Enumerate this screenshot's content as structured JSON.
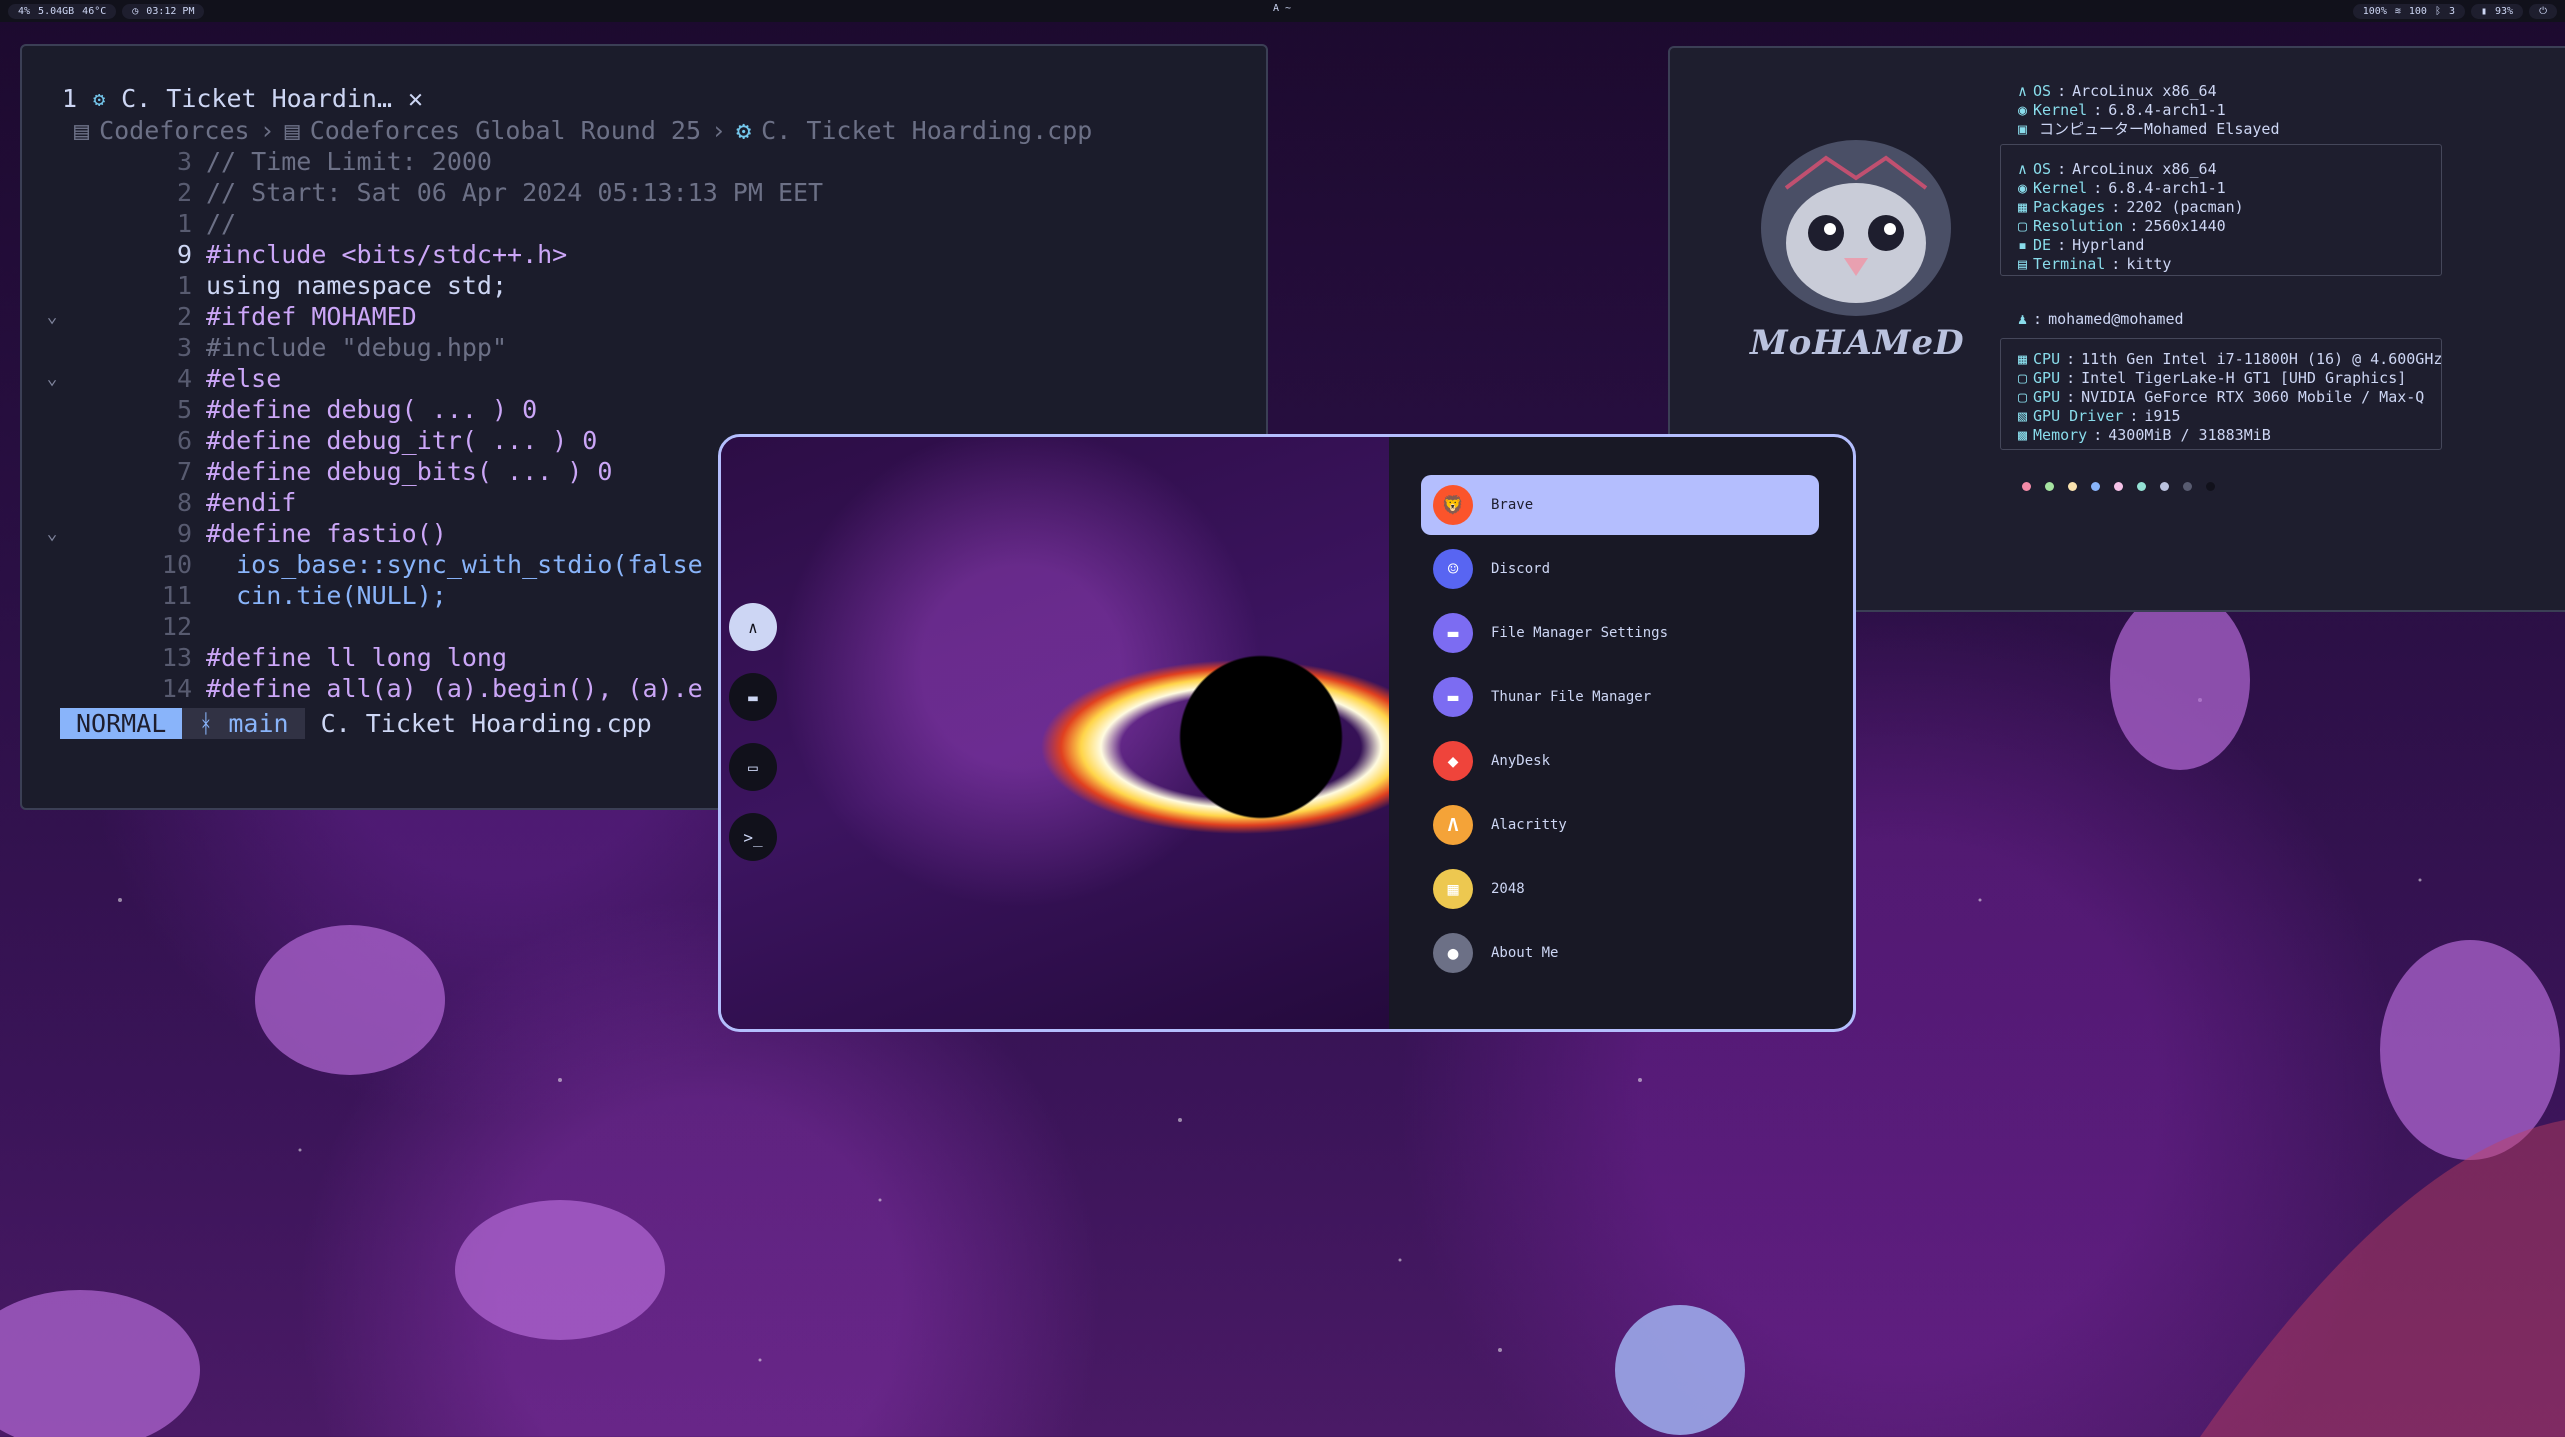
{
  "topbar": {
    "left": {
      "cpu": "4%",
      "mem": "5.04GB",
      "temp": "46°C",
      "clock": "03:12 PM"
    },
    "center": "A ~",
    "right": {
      "brightness": "100%",
      "volume": "100",
      "notifications": "3",
      "battery": "93%"
    }
  },
  "editor": {
    "tab_number": "1",
    "tab_title": "C. Ticket Hoardin…",
    "tab_close": "✕",
    "breadcrumb": [
      "Codeforces",
      "Codeforces Global Round 25",
      "C. Ticket Hoarding.cpp"
    ],
    "lines": [
      {
        "fold": "",
        "num": "3",
        "text": "// Time Limit: 2000",
        "kind": "comment"
      },
      {
        "fold": "",
        "num": "2",
        "text": "// Start: Sat 06 Apr 2024 05:13:13 PM EET",
        "kind": "comment"
      },
      {
        "fold": "",
        "num": "1",
        "text": "//",
        "kind": "comment"
      },
      {
        "fold": "",
        "num": "9",
        "text": "#include <bits/stdc++.h>",
        "kind": "include",
        "current": true
      },
      {
        "fold": "",
        "num": "1",
        "text": "using namespace std;",
        "kind": "plain"
      },
      {
        "fold": "⌄",
        "num": "2",
        "text": "#ifdef MOHAMED",
        "kind": "pre"
      },
      {
        "fold": "",
        "num": "3",
        "text": "#include \"debug.hpp\"",
        "kind": "comment"
      },
      {
        "fold": "⌄",
        "num": "4",
        "text": "#else",
        "kind": "pre"
      },
      {
        "fold": "",
        "num": "5",
        "text": "#define debug( ... ) 0",
        "kind": "define"
      },
      {
        "fold": "",
        "num": "6",
        "text": "#define debug_itr( ... ) 0",
        "kind": "define"
      },
      {
        "fold": "",
        "num": "7",
        "text": "#define debug_bits( ... ) 0",
        "kind": "define"
      },
      {
        "fold": "",
        "num": "8",
        "text": "#endif",
        "kind": "pre"
      },
      {
        "fold": "⌄",
        "num": "9",
        "text": "#define fastio()",
        "kind": "pre"
      },
      {
        "fold": "",
        "num": "10",
        "text": "  ios_base::sync_with_stdio(false",
        "kind": "fn"
      },
      {
        "fold": "",
        "num": "11",
        "text": "  cin.tie(NULL);",
        "kind": "fn"
      },
      {
        "fold": "",
        "num": "12",
        "text": "",
        "kind": "plain"
      },
      {
        "fold": "",
        "num": "13",
        "text": "#define ll long long",
        "kind": "pre"
      },
      {
        "fold": "",
        "num": "14",
        "text": "#define all(a) (a).begin(), (a).e",
        "kind": "pre"
      }
    ],
    "status": {
      "mode": "NORMAL",
      "branch": " main",
      "file": "C. Ticket Hoarding.cpp"
    }
  },
  "fetch": {
    "logo_text": "MoHAMeD",
    "header": [
      {
        "key": "OS",
        "value": "ArcoLinux x86_64"
      },
      {
        "key": "Kernel",
        "value": "6.8.4-arch1-1"
      },
      {
        "key": "",
        "value": "コンピューターMohamed Elsayed"
      }
    ],
    "system": [
      {
        "key": "OS",
        "value": "ArcoLinux x86_64"
      },
      {
        "key": "Kernel",
        "value": "6.8.4-arch1-1"
      },
      {
        "key": "Packages",
        "value": "2202 (pacman)"
      },
      {
        "key": "Resolution",
        "value": "2560x1440"
      },
      {
        "key": "DE",
        "value": "Hyprland"
      },
      {
        "key": "Terminal",
        "value": "kitty"
      }
    ],
    "user": "mohamed@mohamed",
    "hardware": [
      {
        "key": "CPU",
        "value": "11th Gen Intel i7-11800H (16) @ 4.600GHz"
      },
      {
        "key": "GPU",
        "value": "Intel TigerLake-H GT1 [UHD Graphics]"
      },
      {
        "key": "GPU",
        "value": "NVIDIA GeForce RTX 3060 Mobile / Max-Q"
      },
      {
        "key": "GPU Driver",
        "value": "i915"
      },
      {
        "key": "Memory",
        "value": "4300MiB / 31883MiB"
      }
    ],
    "palette": [
      "#f38ba8",
      "#a6e3a1",
      "#f9e2af",
      "#89b4fa",
      "#f5c2e7",
      "#94e2d5",
      "#bac2de",
      "#585b70",
      "#11111b"
    ]
  },
  "launcher": {
    "side_icons": [
      "app-launcher-icon",
      "folder-icon",
      "window-icon",
      "terminal-icon"
    ],
    "apps": [
      {
        "name": "Brave",
        "icon": "brave-icon",
        "color": "#fb542b",
        "glyph": "🦁",
        "selected": true
      },
      {
        "name": "Discord",
        "icon": "discord-icon",
        "color": "#5865f2",
        "glyph": "☺"
      },
      {
        "name": "File Manager Settings",
        "icon": "folder-settings-icon",
        "color": "#7c6cf2",
        "glyph": "▬"
      },
      {
        "name": "Thunar File Manager",
        "icon": "thunar-icon",
        "color": "#7c6cf2",
        "glyph": "▬"
      },
      {
        "name": "AnyDesk",
        "icon": "anydesk-icon",
        "color": "#ef443b",
        "glyph": "◆"
      },
      {
        "name": "Alacritty",
        "icon": "alacritty-icon",
        "color": "#f4a338",
        "glyph": "Λ"
      },
      {
        "name": "2048",
        "icon": "2048-icon",
        "color": "#edc850",
        "glyph": "▦"
      },
      {
        "name": "About Me",
        "icon": "user-icon",
        "color": "#6c7086",
        "glyph": "●"
      }
    ]
  }
}
